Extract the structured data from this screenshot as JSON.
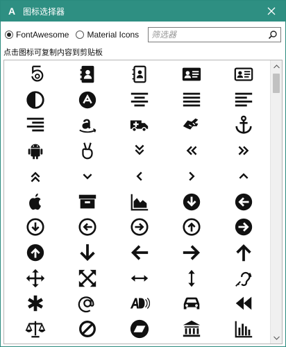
{
  "window": {
    "title": "图标选择器",
    "logo_letter": "A",
    "accent_color": "#2e8f82"
  },
  "toolbar": {
    "radio_fontawesome": "FontAwesome",
    "radio_material": "Material Icons",
    "selected": "FontAwesome",
    "search_placeholder": "筛选器",
    "search_value": ""
  },
  "hint": "点击图标可复制内容到剪贴板",
  "icons": [
    "500px-icon",
    "address-book-icon",
    "address-book-o-icon",
    "address-card-icon",
    "address-card-o-icon",
    "adjust-icon",
    "adn-icon",
    "align-center-icon",
    "align-justify-icon",
    "align-left-icon",
    "align-right-icon",
    "amazon-icon",
    "ambulance-icon",
    "american-sign-language-icon",
    "anchor-icon",
    "android-icon",
    "angellist-icon",
    "angle-double-down-icon",
    "angle-double-left-icon",
    "angle-double-right-icon",
    "angle-double-up-icon",
    "angle-down-icon",
    "angle-left-icon",
    "angle-right-icon",
    "angle-up-icon",
    "apple-icon",
    "archive-icon",
    "area-chart-icon",
    "arrow-circle-down-icon",
    "arrow-circle-left-icon",
    "arrow-circle-o-down-icon",
    "arrow-circle-o-left-icon",
    "arrow-circle-o-right-icon",
    "arrow-circle-o-up-icon",
    "arrow-circle-right-icon",
    "arrow-circle-up-icon",
    "arrow-down-icon",
    "arrow-left-icon",
    "arrow-right-icon",
    "arrow-up-icon",
    "arrows-icon",
    "arrows-alt-icon",
    "arrows-h-icon",
    "arrows-v-icon",
    "assistive-listening-icon",
    "asterisk-icon",
    "at-icon",
    "audio-description-icon",
    "automobile-icon",
    "backward-icon",
    "balance-scale-icon",
    "ban-icon",
    "bandcamp-icon",
    "bank-icon",
    "bar-chart-icon"
  ]
}
